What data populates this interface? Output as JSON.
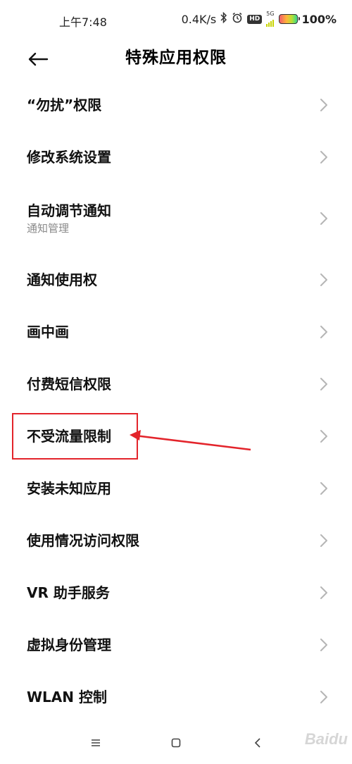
{
  "status_bar": {
    "time": "上午7:48",
    "net_speed": "0.4K/s",
    "hd": "HD",
    "net_type": "5G",
    "battery_percent": "100%",
    "icons": [
      "bluetooth-icon",
      "alarm-icon",
      "hd-icon",
      "signal-icon",
      "battery-icon"
    ]
  },
  "header": {
    "title": "特殊应用权限",
    "back_icon": "back-arrow-icon"
  },
  "list": {
    "items": [
      {
        "label": "“勿扰”权限",
        "sublabel": ""
      },
      {
        "label": "修改系统设置",
        "sublabel": ""
      },
      {
        "label": "自动调节通知",
        "sublabel": "通知管理"
      },
      {
        "label": "通知使用权",
        "sublabel": ""
      },
      {
        "label": "画中画",
        "sublabel": ""
      },
      {
        "label": "付费短信权限",
        "sublabel": ""
      },
      {
        "label": "不受流量限制",
        "sublabel": ""
      },
      {
        "label": "安装未知应用",
        "sublabel": ""
      },
      {
        "label": "使用情况访问权限",
        "sublabel": ""
      },
      {
        "label": "VR 助手服务",
        "sublabel": ""
      },
      {
        "label": "虚拟身份管理",
        "sublabel": ""
      },
      {
        "label": "WLAN 控制",
        "sublabel": ""
      }
    ]
  },
  "annotation": {
    "highlight_color": "#e3242b"
  },
  "nav_bar": {
    "icons": [
      "menu-icon",
      "home-icon",
      "back-icon"
    ]
  },
  "watermark": {
    "text": "Baidu"
  }
}
